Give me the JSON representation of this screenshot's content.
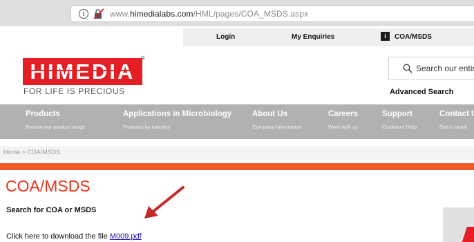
{
  "browser": {
    "url_prefix": "www.",
    "url_domain": "himedialabs.com",
    "url_path": "/HML/pages/COA_MSDS.aspx"
  },
  "topbar": {
    "login": "Login",
    "enquiries": "My Enquiries",
    "coa_msds": "COA/MSDS",
    "coa_icon": "info-icon"
  },
  "logo": {
    "text": "HIMEDIA",
    "registered": "®",
    "tagline": "FOR LIFE IS PRECIOUS"
  },
  "search": {
    "placeholder": "Search our entire",
    "advanced": "Advanced Search"
  },
  "nav": [
    {
      "title": "Products",
      "subtitle": "Browse our product range"
    },
    {
      "title": "Applications in Microbiology",
      "subtitle": "Products by industry"
    },
    {
      "title": "About Us",
      "subtitle": "Company Information"
    },
    {
      "title": "Careers",
      "subtitle": "Work with us"
    },
    {
      "title": "Support",
      "subtitle": "Customer Help"
    },
    {
      "title": "Contact U",
      "subtitle": "Get in touch"
    }
  ],
  "breadcrumb": "Home > COA/MSDS",
  "main": {
    "heading": "COA/MSDS",
    "subheading": "Search for COA or MSDS",
    "download_text": "Click here to download the file ",
    "download_link": "M009.pdf"
  },
  "colors": {
    "brand_red": "#e31e24",
    "accent_orange": "#f05a2b",
    "nav_gray": "#b1b1b1",
    "heading_red": "#e8341c",
    "annotation_arrow": "#c62828"
  }
}
